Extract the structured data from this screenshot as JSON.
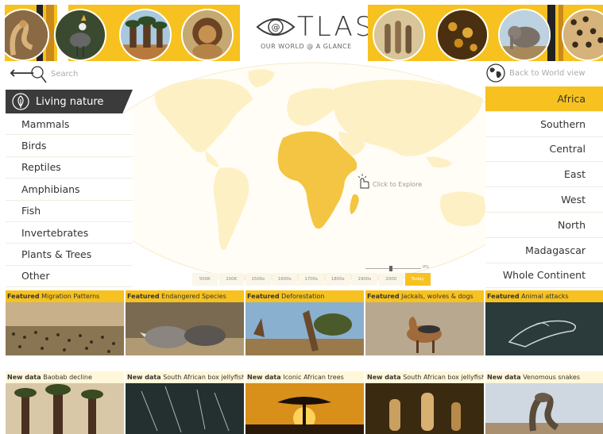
{
  "logo": {
    "wordmark": "TLAS",
    "at_symbol": "@",
    "tagline": "OUR WORLD @ A GLANCE"
  },
  "search": {
    "placeholder": "Search"
  },
  "world_view_link": "Back to World view",
  "map_hint": "Click to Explore",
  "left_menu": {
    "header": "Living nature",
    "items": [
      "Mammals",
      "Birds",
      "Reptiles",
      "Amphibians",
      "Fish",
      "Invertebrates",
      "Plants & Trees",
      "Other"
    ]
  },
  "right_menu": {
    "items": [
      "Africa",
      "Southern",
      "Central",
      "East",
      "West",
      "North",
      "Madagascar",
      "Whole Continent"
    ],
    "active_index": 0
  },
  "timeline": {
    "labels": [
      "500K",
      "100K",
      "1500s",
      "1600s",
      "1700s",
      "1800s",
      "1900s",
      "2000",
      "Today"
    ],
    "active": "Today",
    "slider_label": "0%"
  },
  "featured": [
    {
      "tag": "Featured",
      "title": "Migration Patterns"
    },
    {
      "tag": "Featured",
      "title": "Endangered Species"
    },
    {
      "tag": "Featured",
      "title": "Deforestation"
    },
    {
      "tag": "Featured",
      "title": "Jackals, wolves & dogs"
    },
    {
      "tag": "Featured",
      "title": "Animal attacks"
    }
  ],
  "new_data": [
    {
      "tag": "New data",
      "title": "Baobab decline"
    },
    {
      "tag": "New data",
      "title": "South African box jellyfish"
    },
    {
      "tag": "New data",
      "title": "Iconic African trees"
    },
    {
      "tag": "New data",
      "title": "South African box jellyfish"
    },
    {
      "tag": "New data",
      "title": "Venomous snakes"
    }
  ],
  "colors": {
    "accent": "#f7c21f",
    "map_land": "#fdf0c4",
    "africa": "#f4c542",
    "dark": "#3b3b3b"
  }
}
